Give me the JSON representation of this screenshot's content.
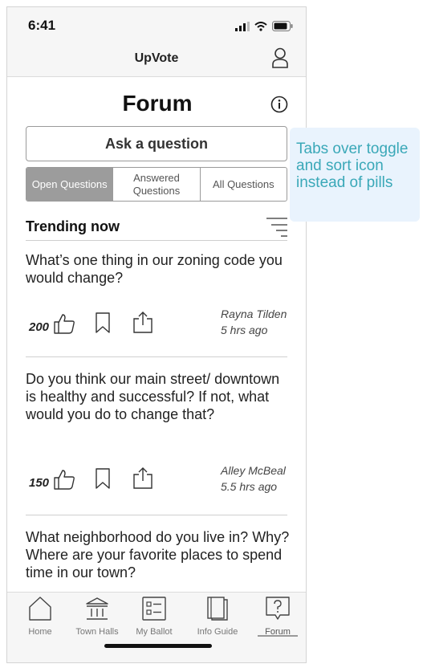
{
  "status": {
    "time": "6:41"
  },
  "header": {
    "title": "UpVote"
  },
  "page": {
    "title": "Forum"
  },
  "ask_button": "Ask a question",
  "tabs": [
    "Open Questions",
    "Answered Questions",
    "All Questions"
  ],
  "section": {
    "title": "Trending now"
  },
  "questions": [
    {
      "text": "What’s one thing in our zoning code you would change?",
      "votes": "200",
      "author": "Rayna Tilden",
      "time": "5 hrs ago"
    },
    {
      "text": "Do you think our main street/ downtown is healthy and successful? If not, what would you do to change that?",
      "votes": "150",
      "author": "Alley McBeal",
      "time": "5.5 hrs ago"
    },
    {
      "text": "What neighborhood do you live in? Why? Where are your favorite places to spend time in our town?"
    }
  ],
  "nav": [
    {
      "label": "Home",
      "icon": "home-icon"
    },
    {
      "label": "Town Halls",
      "icon": "town-hall-icon"
    },
    {
      "label": "My Ballot",
      "icon": "ballot-icon"
    },
    {
      "label": "Info Guide",
      "icon": "book-icon"
    },
    {
      "label": "Forum",
      "icon": "forum-icon"
    }
  ],
  "annotation": "Tabs over toggle and sort icon instead of pills",
  "colors": {
    "active_tab": "#9c9c9c",
    "note_bg": "#e9f3fd",
    "note_text": "#3aa8b8"
  }
}
